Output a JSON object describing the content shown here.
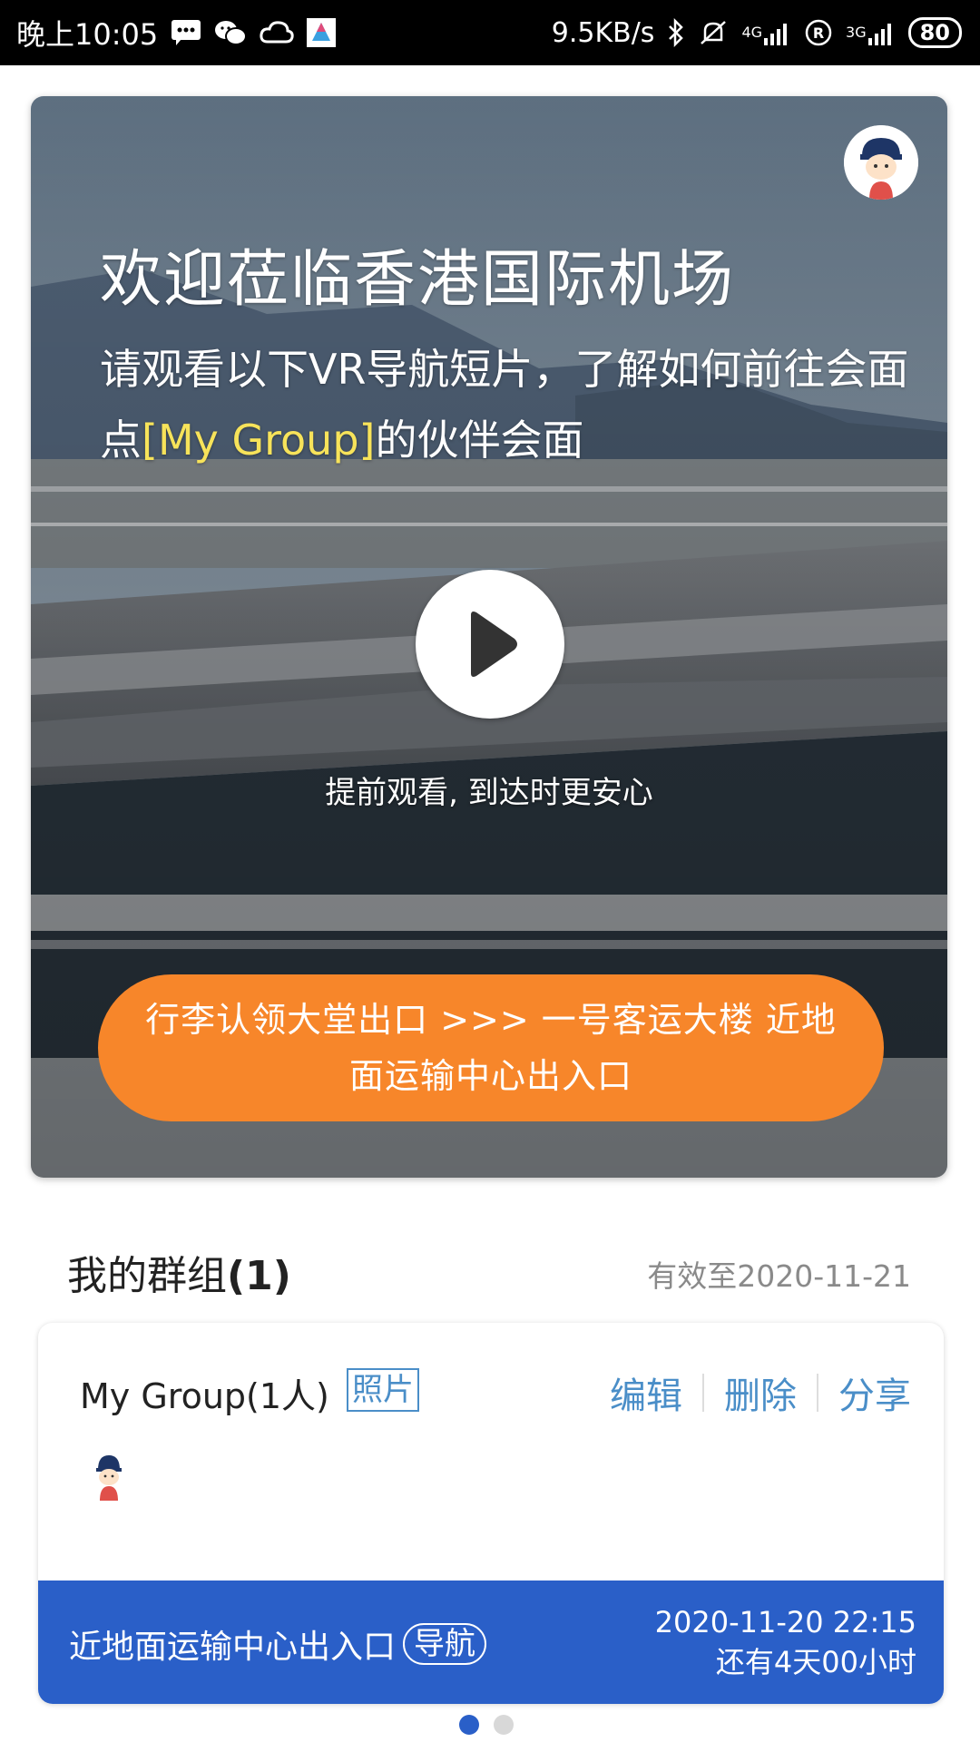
{
  "status_bar": {
    "time": "晚上10:05",
    "net_speed": "9.5KB/s",
    "net_4g": "4G",
    "net_3g": "3G",
    "battery": "80",
    "icons": [
      "message-icon",
      "wechat-icon",
      "cloud-icon",
      "app-icon",
      "bluetooth-icon",
      "mute-icon",
      "signal-4g-icon",
      "roaming-icon",
      "signal-3g-icon",
      "battery-icon"
    ]
  },
  "hero": {
    "title": "欢迎莅临香港国际机场",
    "subtitle_prefix": "请观看以下VR导航短片，了解如何前往会面点",
    "subtitle_highlight": "[My Group]",
    "subtitle_suffix": "的伙伴会面",
    "play_hint": "提前观看, 到达时更安心",
    "route_label": "行李认领大堂出口 >>> 一号客运大楼 近地面运输中心出入口",
    "colors": {
      "highlight": "#f7e35a",
      "route_button": "#f7862a"
    }
  },
  "groups": {
    "title": "我的群组",
    "count": "(1)",
    "valid_until": "有效至2020-11-21"
  },
  "group_card": {
    "name": "My Group(1人)",
    "photo_label": "照片",
    "edit_label": "编辑",
    "delete_label": "删除",
    "share_label": "分享",
    "destination": "近地面运输中心出入口",
    "nav_label": "导航",
    "datetime": "2020-11-20 22:15",
    "remaining": "还有4天00小时",
    "colors": {
      "footer": "#2a5fc8",
      "link": "#4a8ec8"
    }
  },
  "pager": {
    "pages": 2,
    "active": 1
  }
}
